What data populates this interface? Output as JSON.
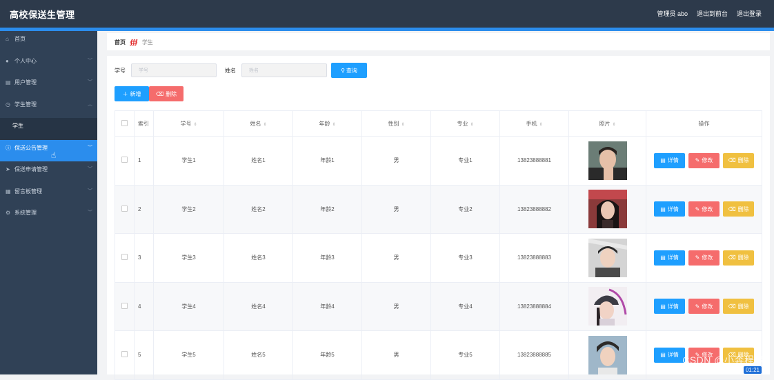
{
  "header": {
    "title": "高校保送生管理",
    "admin_label": "管理员 abo",
    "exit_front": "退出到前台",
    "logout": "退出登录"
  },
  "sidebar": {
    "items": [
      {
        "label": "首页",
        "icon": "home-icon"
      },
      {
        "label": "个人中心",
        "icon": "user-icon"
      },
      {
        "label": "用户管理",
        "icon": "folder-icon"
      },
      {
        "label": "学生管理",
        "icon": "clock-icon"
      },
      {
        "label": "学生",
        "icon": ""
      },
      {
        "label": "保送公告管理",
        "icon": "info-icon"
      },
      {
        "label": "保送申请管理",
        "icon": "send-icon"
      },
      {
        "label": "留言板管理",
        "icon": "board-icon"
      },
      {
        "label": "系统管理",
        "icon": "gear-icon"
      }
    ]
  },
  "breadcrumb": {
    "home": "首页",
    "current": "学生"
  },
  "search": {
    "id_label": "学号",
    "id_placeholder": "学号",
    "name_label": "姓名",
    "name_placeholder": "姓名",
    "query_label": "查询"
  },
  "toolbar": {
    "add_label": "新增",
    "delete_label": "删除"
  },
  "table": {
    "headers": {
      "index": "索引",
      "student_id": "学号",
      "name": "姓名",
      "age": "年龄",
      "gender": "性别",
      "major": "专业",
      "phone": "手机",
      "photo": "照片",
      "actions": "操作"
    },
    "action_labels": {
      "detail": "详情",
      "edit": "修改",
      "remove": "删除"
    },
    "rows": [
      {
        "index": "1",
        "student_id": "学生1",
        "name": "姓名1",
        "age": "年龄1",
        "gender": "男",
        "major": "专业1",
        "phone": "13823888881"
      },
      {
        "index": "2",
        "student_id": "学生2",
        "name": "姓名2",
        "age": "年龄2",
        "gender": "男",
        "major": "专业2",
        "phone": "13823888882"
      },
      {
        "index": "3",
        "student_id": "学生3",
        "name": "姓名3",
        "age": "年龄3",
        "gender": "男",
        "major": "专业3",
        "phone": "13823888883"
      },
      {
        "index": "4",
        "student_id": "学生4",
        "name": "姓名4",
        "age": "年龄4",
        "gender": "男",
        "major": "专业4",
        "phone": "13823888884"
      },
      {
        "index": "5",
        "student_id": "学生5",
        "name": "姓名5",
        "age": "年龄5",
        "gender": "男",
        "major": "专业5",
        "phone": "13823888885"
      }
    ]
  },
  "overlay": {
    "watermark": "CSDN @小奔程序",
    "timer": "01:21"
  },
  "colors": {
    "topbar": "#2d3a4b",
    "sidebar": "#304156",
    "accent": "#2b8ded",
    "primary_button": "#1e9fff",
    "danger_button": "#f56c6c",
    "warning_button": "#f0c040"
  }
}
